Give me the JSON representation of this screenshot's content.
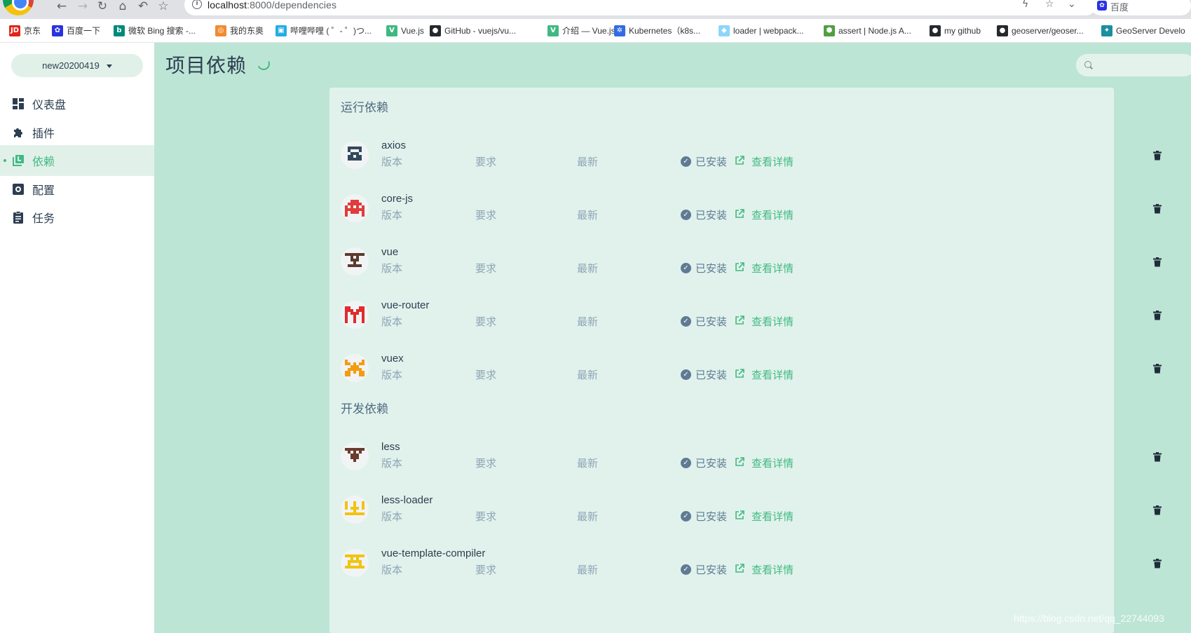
{
  "browser": {
    "url_host": "localhost",
    "url_path": ":8000/dependencies",
    "search_engine_label": "百度",
    "bookmarks": [
      {
        "label": "京东",
        "icon": "jd-icon",
        "color": "#e1251b",
        "glyph": "JD"
      },
      {
        "label": "百度一下",
        "icon": "baidu-paw-icon",
        "color": "#2932e1",
        "glyph": "✿"
      },
      {
        "label": "微软 Bing 搜索 -...",
        "icon": "bing-icon",
        "color": "#00897b",
        "glyph": "b"
      },
      {
        "label": "我的东奥",
        "icon": "weibo-icon",
        "color": "#f28b30",
        "glyph": "◎"
      },
      {
        "label": "哔哩哔哩 ( ゜- ゜)つ...",
        "icon": "bilibili-icon",
        "color": "#23ade5",
        "glyph": "▣"
      },
      {
        "label": "Vue.js",
        "icon": "vue-icon",
        "color": "#41b883",
        "glyph": "V"
      },
      {
        "label": "GitHub - vuejs/vu...",
        "icon": "github-icon",
        "color": "#24292e",
        "glyph": "●"
      },
      {
        "label": "介绍 — Vue.js",
        "icon": "vue-icon",
        "color": "#41b883",
        "glyph": "V"
      },
      {
        "label": "Kubernetes（k8s...",
        "icon": "kubernetes-icon",
        "color": "#326ce5",
        "glyph": "✲"
      },
      {
        "label": "loader | webpack...",
        "icon": "webpack-icon",
        "color": "#8dd6f9",
        "glyph": "◆"
      },
      {
        "label": "assert | Node.js A...",
        "icon": "nodejs-icon",
        "color": "#539e43",
        "glyph": "⬢"
      },
      {
        "label": "my github",
        "icon": "github-icon",
        "color": "#24292e",
        "glyph": "●"
      },
      {
        "label": "geoserver/geoser...",
        "icon": "github-icon",
        "color": "#24292e",
        "glyph": "●"
      },
      {
        "label": "GeoServer Develo",
        "icon": "geoserver-icon",
        "color": "#1a8f9e",
        "glyph": "✦"
      }
    ]
  },
  "app": {
    "project_name": "new20200419",
    "nav": [
      {
        "label": "仪表盘",
        "icon": "dashboard-icon",
        "active": false
      },
      {
        "label": "插件",
        "icon": "puzzle-icon",
        "active": false
      },
      {
        "label": "依赖",
        "icon": "library-icon",
        "active": true
      },
      {
        "label": "配置",
        "icon": "settings-icon",
        "active": false
      },
      {
        "label": "任务",
        "icon": "clipboard-icon",
        "active": false
      }
    ],
    "page_title": "项目依赖",
    "search_placeholder": ""
  },
  "columns": {
    "version": "版本",
    "wanted": "要求",
    "latest": "最新"
  },
  "status_installed": "已安装",
  "details_label": "查看详情",
  "sections": [
    {
      "title": "运行依赖",
      "deps": [
        {
          "name": "axios",
          "logo_color": "#34495e",
          "pattern": "axios"
        },
        {
          "name": "core-js",
          "logo_color": "#e03c3c",
          "pattern": "corejs"
        },
        {
          "name": "vue",
          "logo_color": "#5d3a2e",
          "pattern": "vue"
        },
        {
          "name": "vue-router",
          "logo_color": "#e02c2c",
          "pattern": "router"
        },
        {
          "name": "vuex",
          "logo_color": "#f39c12",
          "pattern": "vuex"
        }
      ]
    },
    {
      "title": "开发依赖",
      "deps": [
        {
          "name": "less",
          "logo_color": "#6b3b2e",
          "pattern": "less"
        },
        {
          "name": "less-loader",
          "logo_color": "#f1c40f",
          "pattern": "lessloader"
        },
        {
          "name": "vue-template-compiler",
          "logo_color": "#f1c40f",
          "pattern": "vtc"
        }
      ]
    }
  ],
  "watermark": "https://blog.csdn.net/qq_22744093",
  "colors": {
    "accent": "#42b983",
    "content_bg": "#bde5d6",
    "panel_bg": "#e1f2ec"
  }
}
